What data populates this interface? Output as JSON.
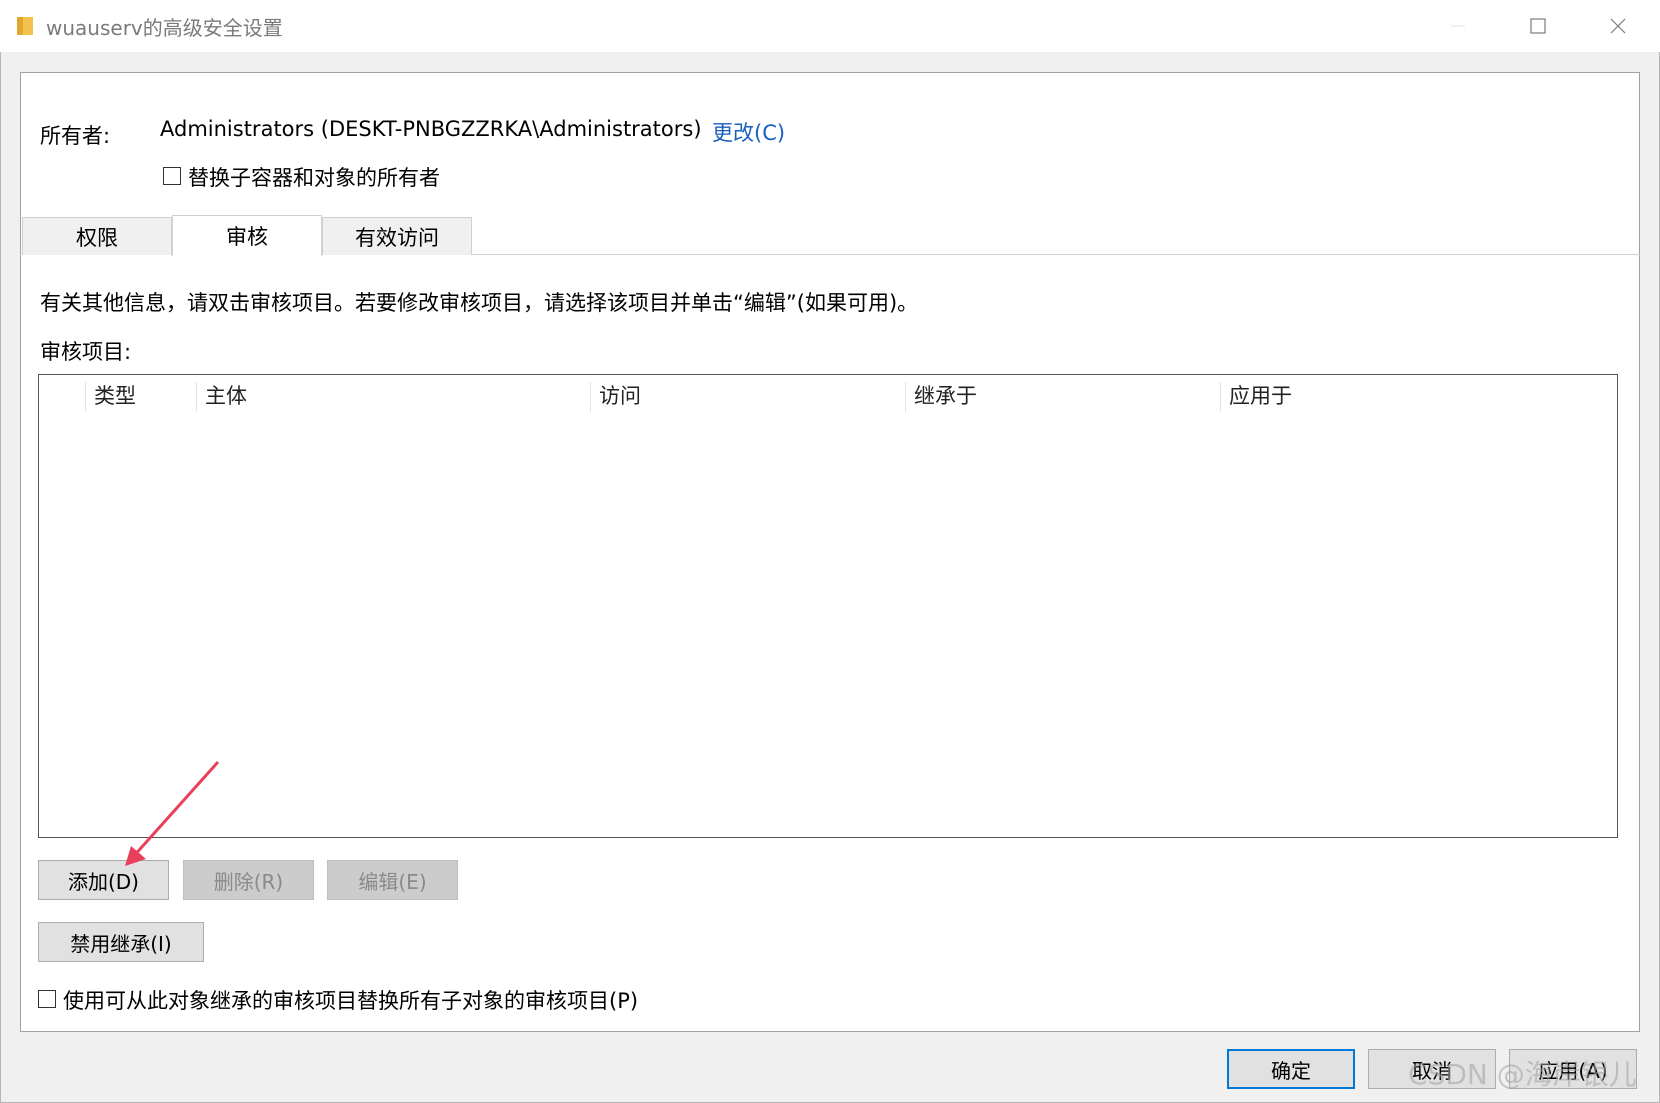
{
  "window": {
    "title": "wuauserv的高级安全设置"
  },
  "owner": {
    "label": "所有者:",
    "value": "Administrators (DESKT-PNBGZZRKA\\Administrators)",
    "change_link": "更改(C)",
    "replace_checkbox_label": "替换子容器和对象的所有者",
    "replace_checked": false
  },
  "tabs": [
    {
      "label": "权限",
      "selected": false
    },
    {
      "label": "审核",
      "selected": true
    },
    {
      "label": "有效访问",
      "selected": false
    }
  ],
  "audit": {
    "info_text": "有关其他信息，请双击审核项目。若要修改审核项目，请选择该项目并单击“编辑”(如果可用)。",
    "items_label": "审核项目:",
    "columns": [
      "类型",
      "主体",
      "访问",
      "继承于",
      "应用于"
    ],
    "rows": []
  },
  "buttons": {
    "add": "添加(D)",
    "remove": "删除(R)",
    "edit": "编辑(E)",
    "disable_inheritance": "禁用继承(I)",
    "ok": "确定",
    "cancel": "取消",
    "apply": "应用(A)"
  },
  "replace_child": {
    "label": "使用可从此对象继承的审核项目替换所有子对象的审核项目(P)",
    "checked": false
  },
  "watermark": "CSDN @海岸银儿",
  "colors": {
    "link": "#1a5fbf",
    "ok_border": "#0078d7",
    "annotation_arrow": "#e8405a"
  },
  "icons": {
    "title": "folder-icon",
    "minimize": "minimize-icon",
    "maximize": "maximize-icon",
    "close": "close-icon"
  }
}
